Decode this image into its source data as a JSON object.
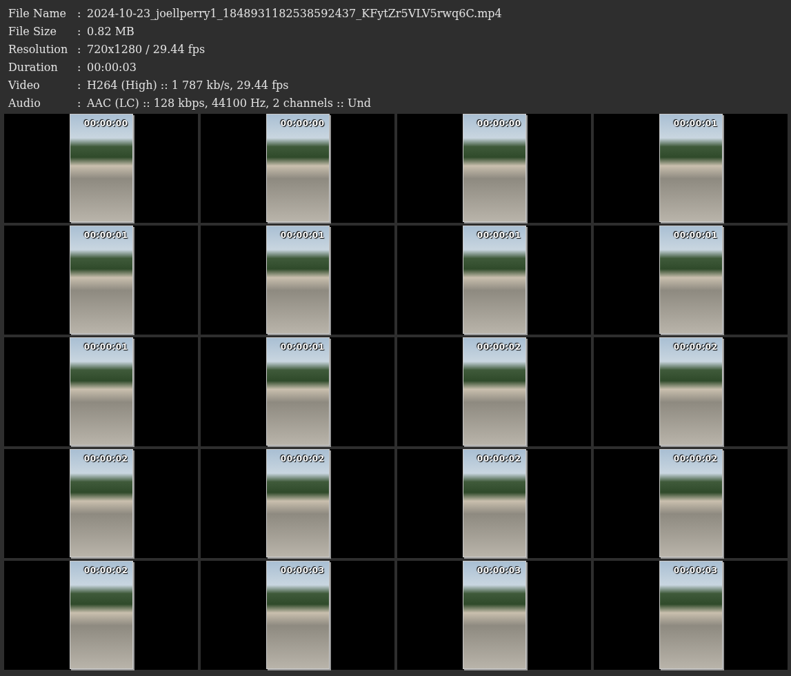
{
  "info": [
    {
      "label": "File Name",
      "value": "2024-10-23_joellperry1_1848931182538592437_KFytZr5VLV5rwq6C.mp4"
    },
    {
      "label": "File Size",
      "value": "0.82 MB"
    },
    {
      "label": "Resolution",
      "value": "720x1280 / 29.44 fps"
    },
    {
      "label": "Duration",
      "value": "00:00:03"
    },
    {
      "label": "Video",
      "value": "H264 (High) :: 1 787 kb/s, 29.44 fps"
    },
    {
      "label": "Audio",
      "value": "AAC (LC) :: 128 kbps, 44100 Hz, 2 channels :: Und"
    }
  ],
  "separator": ":",
  "frames": [
    {
      "time": "00:00:00"
    },
    {
      "time": "00:00:00"
    },
    {
      "time": "00:00:00"
    },
    {
      "time": "00:00:01"
    },
    {
      "time": "00:00:01"
    },
    {
      "time": "00:00:01"
    },
    {
      "time": "00:00:01"
    },
    {
      "time": "00:00:01"
    },
    {
      "time": "00:00:01"
    },
    {
      "time": "00:00:01"
    },
    {
      "time": "00:00:02"
    },
    {
      "time": "00:00:02"
    },
    {
      "time": "00:00:02"
    },
    {
      "time": "00:00:02"
    },
    {
      "time": "00:00:02"
    },
    {
      "time": "00:00:02"
    },
    {
      "time": "00:00:02"
    },
    {
      "time": "00:00:03"
    },
    {
      "time": "00:00:03"
    },
    {
      "time": "00:00:03"
    }
  ]
}
